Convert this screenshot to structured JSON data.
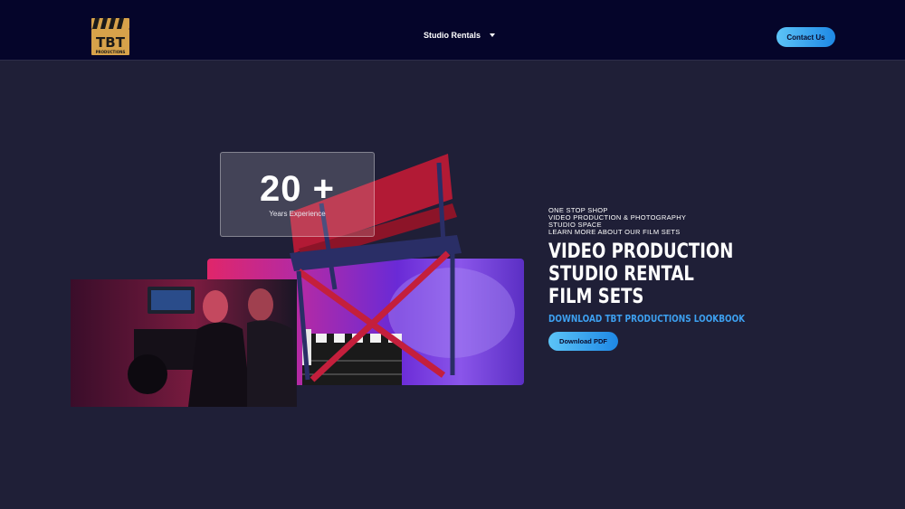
{
  "header": {
    "logo_alt": "TBT Productions",
    "logo_text": "TBT",
    "logo_subtext": "PRODUCTIONS",
    "nav": [
      {
        "label": "Studio Rentals"
      }
    ],
    "contact_label": "Contact Us"
  },
  "hero": {
    "stat": {
      "number": "20 +",
      "label": "Years Experience"
    },
    "eyebrow": [
      "ONE STOP SHOP",
      "VIDEO PRODUCTION & PHOTOGRAPHY",
      "STUDIO SPACE",
      "LEARN MORE ABOUT OUR FILM SETS"
    ],
    "headline": [
      "VIDEO PRODUCTION",
      "STUDIO RENTAL",
      "FILM SETS"
    ],
    "lookbook": "DOWNLOAD TBT PRODUCTIONS LOOKBOOK",
    "download_label": "Download PDF"
  },
  "colors": {
    "header_bg": "#05052a",
    "page_bg": "#1f1f37",
    "accent": "#3da0f0",
    "button_gradient_start": "#5cc4f7",
    "button_gradient_end": "#1e88e5"
  },
  "icons": {
    "logo": "clapperboard-logo-icon",
    "nav_caret": "caret-down-icon"
  }
}
